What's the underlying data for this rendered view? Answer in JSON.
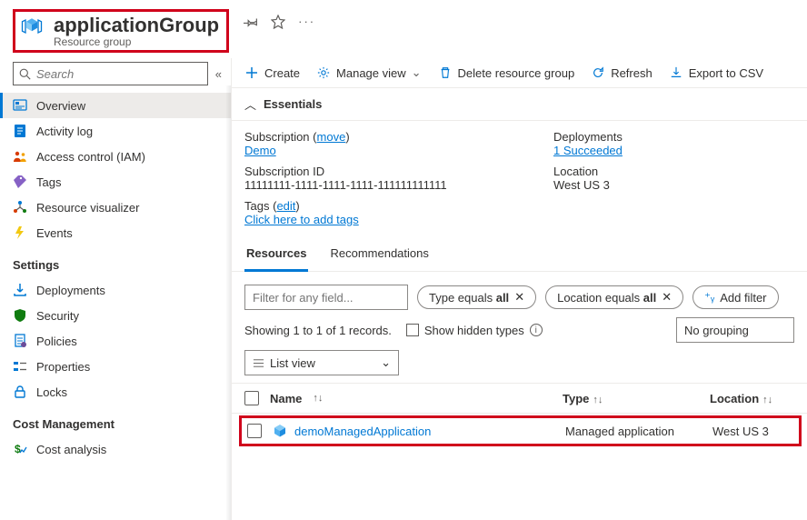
{
  "header": {
    "title": "applicationGroup",
    "subtitle": "Resource group"
  },
  "sidebar": {
    "search_placeholder": "Search",
    "items": [
      {
        "label": "Overview"
      },
      {
        "label": "Activity log"
      },
      {
        "label": "Access control (IAM)"
      },
      {
        "label": "Tags"
      },
      {
        "label": "Resource visualizer"
      },
      {
        "label": "Events"
      }
    ],
    "settings_heading": "Settings",
    "settings_items": [
      {
        "label": "Deployments"
      },
      {
        "label": "Security"
      },
      {
        "label": "Policies"
      },
      {
        "label": "Properties"
      },
      {
        "label": "Locks"
      }
    ],
    "cost_heading": "Cost Management",
    "cost_items": [
      {
        "label": "Cost analysis"
      }
    ]
  },
  "toolbar": {
    "create": "Create",
    "manage_view": "Manage view",
    "delete": "Delete resource group",
    "refresh": "Refresh",
    "export": "Export to CSV"
  },
  "essentials": {
    "title": "Essentials",
    "subscription_label": "Subscription",
    "subscription_move": "move",
    "subscription_link": "Demo",
    "subscription_id_label": "Subscription ID",
    "subscription_id_value": "11111111-1111-1111-1111-111111111111",
    "deployments_label": "Deployments",
    "deployments_value": "1 Succeeded",
    "location_label": "Location",
    "location_value": "West US 3",
    "tags_label": "Tags",
    "tags_edit": "edit",
    "tags_link": "Click here to add tags"
  },
  "tabs": {
    "resources": "Resources",
    "recommendations": "Recommendations"
  },
  "filters": {
    "filter_placeholder": "Filter for any field...",
    "type_pill_prefix": "Type equals ",
    "type_pill_value": "all",
    "location_pill_prefix": "Location equals ",
    "location_pill_value": "all",
    "add_filter": "Add filter"
  },
  "options": {
    "showing": "Showing 1 to 1 of 1 records.",
    "show_hidden": "Show hidden types",
    "list_view": "List view",
    "no_grouping": "No grouping"
  },
  "table": {
    "headers": {
      "name": "Name",
      "type": "Type",
      "location": "Location"
    },
    "rows": [
      {
        "name": "demoManagedApplication",
        "type": "Managed application",
        "location": "West US 3"
      }
    ]
  }
}
